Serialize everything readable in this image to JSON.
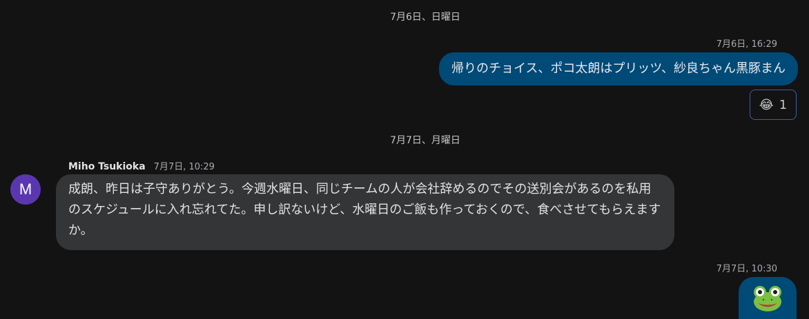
{
  "dividers": {
    "first": "7月6日、日曜日",
    "second": "7月7日、月曜日"
  },
  "messages": {
    "out1": {
      "time": "7月6日, 16:29",
      "text": "帰りのチョイス、ポコ太朗はプリッツ、紗良ちゃん黒豚まん",
      "reaction_emoji": "😂",
      "reaction_count": "1"
    },
    "in1": {
      "avatar_initial": "M",
      "sender": "Miho Tsukioka",
      "time": "7月7日, 10:29",
      "text": "成朗、昨日は子守ありがとう。今週水曜日、同じチームの人が会社辞めるのでその送別会があるのを私用のスケジュールに入れ忘れてた。申し訳ないけど、水曜日のご飯も作っておくので、食べさせてもらえますか。"
    },
    "out2": {
      "time": "7月7日, 10:30",
      "emoji_name": "frog-face-icon"
    }
  },
  "colors": {
    "background": "#131314",
    "outgoing_bubble": "#004a77",
    "incoming_bubble": "#333537",
    "avatar": "#5a37b0",
    "reaction_border": "#3f5f9a"
  }
}
